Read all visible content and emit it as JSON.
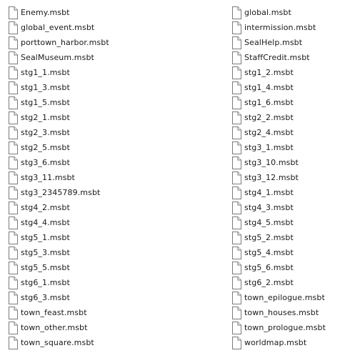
{
  "files": {
    "left": [
      "Enemy.msbt",
      "global_event.msbt",
      "porttown_harbor.msbt",
      "SealMuseum.msbt",
      "stg1_1.msbt",
      "stg1_3.msbt",
      "stg1_5.msbt",
      "stg2_1.msbt",
      "stg2_3.msbt",
      "stg2_5.msbt",
      "stg3_6.msbt",
      "stg3_11.msbt",
      "stg3_2345789.msbt",
      "stg4_2.msbt",
      "stg4_4.msbt",
      "stg5_1.msbt",
      "stg5_3.msbt",
      "stg5_5.msbt",
      "stg6_1.msbt",
      "stg6_3.msbt",
      "town_feast.msbt",
      "town_other.msbt",
      "town_square.msbt"
    ],
    "right": [
      "global.msbt",
      "intermission.msbt",
      "SealHelp.msbt",
      "StaffCredit.msbt",
      "stg1_2.msbt",
      "stg1_4.msbt",
      "stg1_6.msbt",
      "stg2_2.msbt",
      "stg2_4.msbt",
      "stg3_1.msbt",
      "stg3_10.msbt",
      "stg3_12.msbt",
      "stg4_1.msbt",
      "stg4_3.msbt",
      "stg4_5.msbt",
      "stg5_2.msbt",
      "stg5_4.msbt",
      "stg5_6.msbt",
      "stg6_2.msbt",
      "town_epilogue.msbt",
      "town_houses.msbt",
      "town_prologue.msbt",
      "worldmap.msbt"
    ],
    "icon": "generic-file-icon"
  }
}
